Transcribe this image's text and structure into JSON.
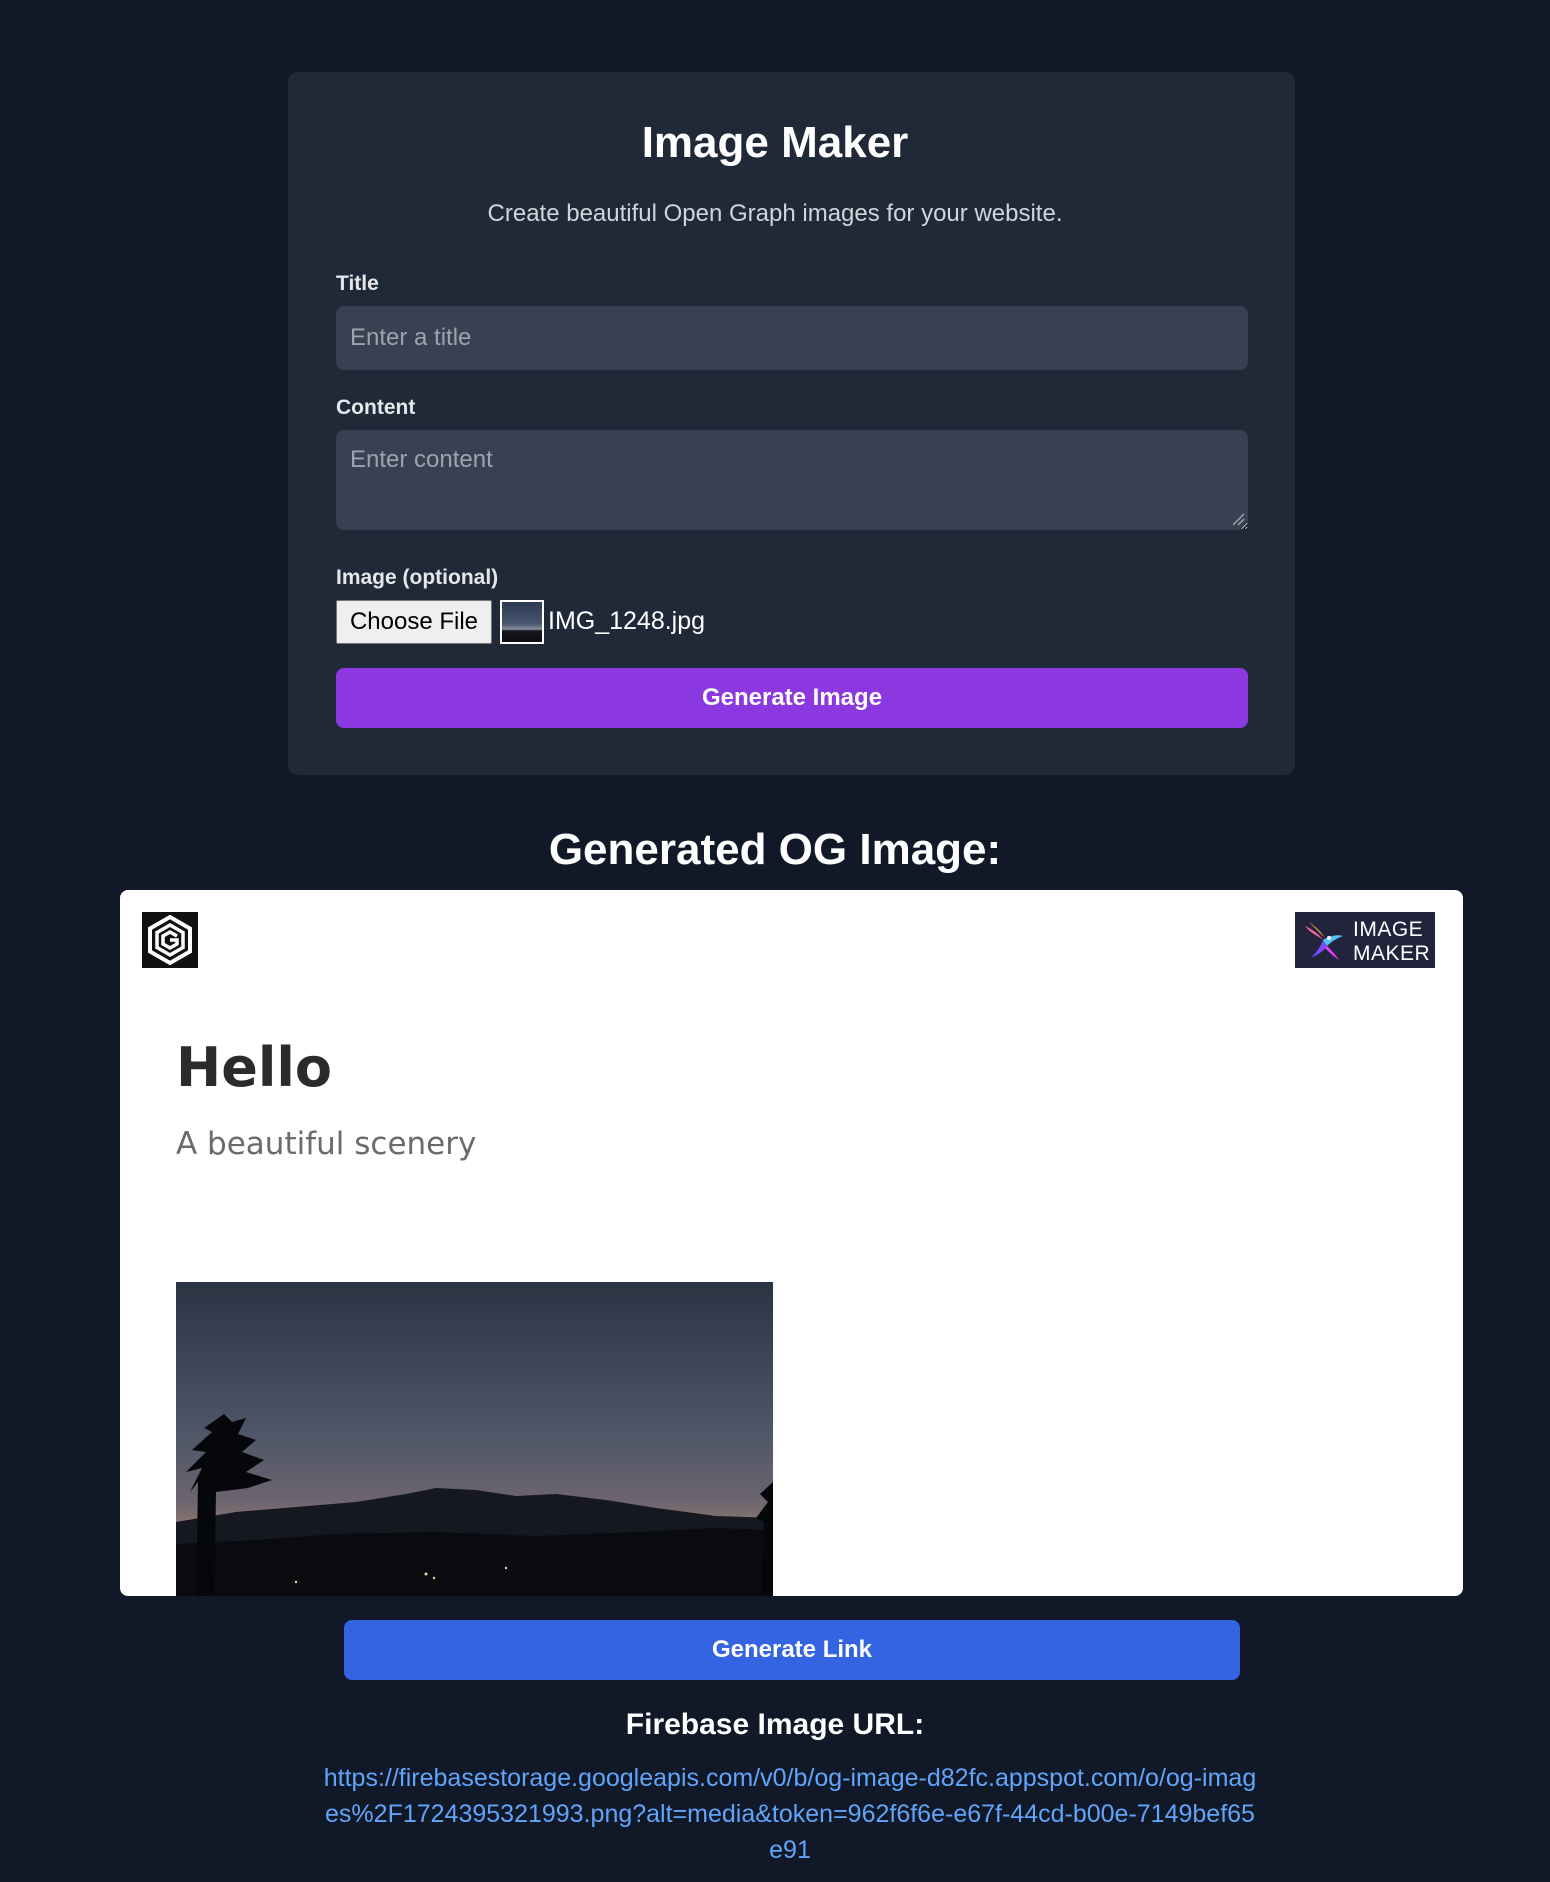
{
  "form": {
    "title": "Image Maker",
    "subtitle": "Create beautiful Open Graph images for your website.",
    "title_label": "Title",
    "title_placeholder": "Enter a title",
    "title_value": "",
    "content_label": "Content",
    "content_placeholder": "Enter content",
    "content_value": "",
    "image_label": "Image (optional)",
    "choose_file_label": "Choose File",
    "file_name": "IMG_1248.jpg",
    "generate_button": "Generate Image"
  },
  "result": {
    "heading": "Generated OG Image:",
    "og_title": "Hello",
    "og_subtitle": "A beautiful scenery",
    "brand_logo_text": "IMAGE MAKER",
    "generate_link_button": "Generate Link",
    "url_heading": "Firebase Image URL:",
    "url": "https://firebasestorage.googleapis.com/v0/b/og-image-d82fc.appspot.com/o/og-images%2F1724395321993.png?alt=media&token=962f6f6e-e67f-44cd-b00e-7149bef65e91"
  },
  "icons": {
    "left_logo": "hexagon-g-logo-icon",
    "right_logo": "hummingbird-logo-icon",
    "resize": "resize-grip-icon"
  },
  "colors": {
    "page_background": "#111827",
    "card_background": "#1f2937",
    "input_background": "#374151",
    "generate_image_button": "#8b38e0",
    "generate_link_button": "#3564e3",
    "link": "#60a5fa"
  }
}
